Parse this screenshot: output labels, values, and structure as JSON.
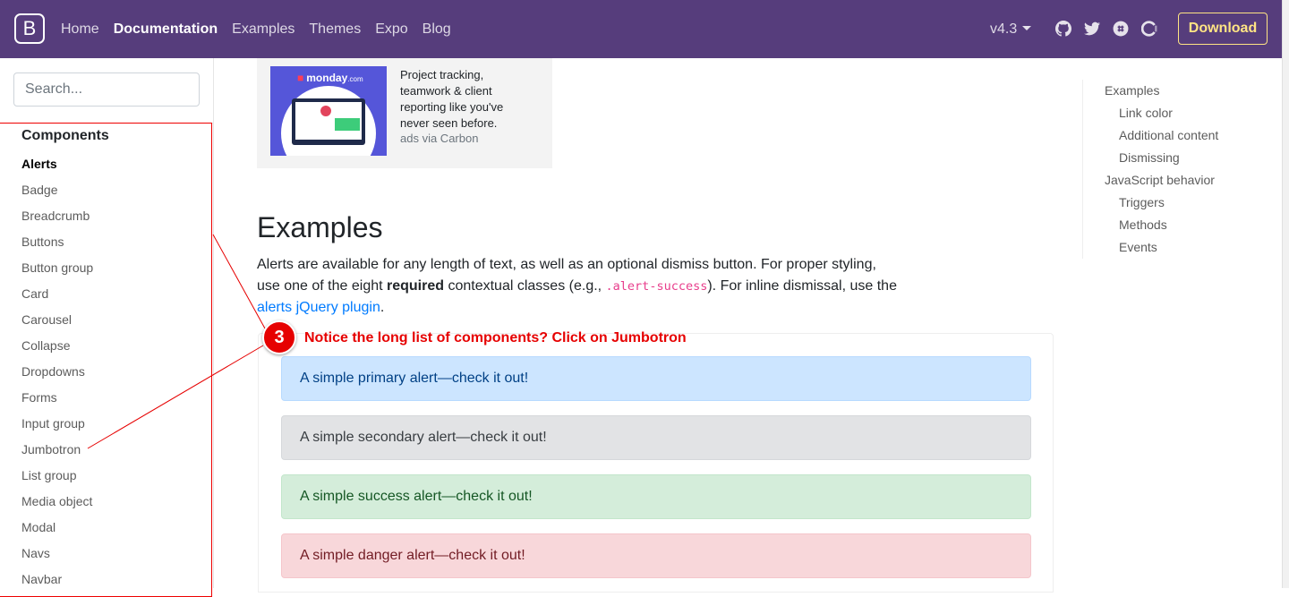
{
  "navbar": {
    "brand": "B",
    "links": [
      "Home",
      "Documentation",
      "Examples",
      "Themes",
      "Expo",
      "Blog"
    ],
    "active": "Documentation",
    "version": "v4.3",
    "icons": [
      "github-icon",
      "twitter-icon",
      "slack-icon",
      "opencollective-icon"
    ],
    "download": "Download"
  },
  "sidebar": {
    "search_placeholder": "Search...",
    "heading": "Components",
    "items": [
      "Alerts",
      "Badge",
      "Breadcrumb",
      "Buttons",
      "Button group",
      "Card",
      "Carousel",
      "Collapse",
      "Dropdowns",
      "Forms",
      "Input group",
      "Jumbotron",
      "List group",
      "Media object",
      "Modal",
      "Navs",
      "Navbar"
    ],
    "active_item": "Alerts"
  },
  "ad": {
    "logo": "monday",
    "logo_suffix": ".com",
    "text": "Project tracking, teamwork & client reporting like you've never seen before.",
    "via": "ads via Carbon"
  },
  "content": {
    "heading": "Examples",
    "para_1": "Alerts are available for any length of text, as well as an optional dismiss button. For proper styling, use one of the eight ",
    "para_bold": "required",
    "para_2": " contextual classes (e.g., ",
    "para_code": ".alert-success",
    "para_3": "). For inline dismissal, use the ",
    "para_link": "alerts jQuery plugin",
    "para_4": ".",
    "alerts": [
      "A simple primary alert—check it out!",
      "A simple secondary alert—check it out!",
      "A simple success alert—check it out!",
      "A simple danger alert—check it out!"
    ]
  },
  "toc": [
    {
      "label": "Examples",
      "level": 1
    },
    {
      "label": "Link color",
      "level": 2
    },
    {
      "label": "Additional content",
      "level": 2
    },
    {
      "label": "Dismissing",
      "level": 2
    },
    {
      "label": "JavaScript behavior",
      "level": 1
    },
    {
      "label": "Triggers",
      "level": 2
    },
    {
      "label": "Methods",
      "level": 2
    },
    {
      "label": "Events",
      "level": 2
    }
  ],
  "annotation": {
    "number": "3",
    "text": "Notice the long list of components? Click on Jumbotron"
  },
  "colors": {
    "navbar": "#563d7c",
    "download": "#ffe484",
    "annotation": "#e60000",
    "link": "#007bff"
  }
}
